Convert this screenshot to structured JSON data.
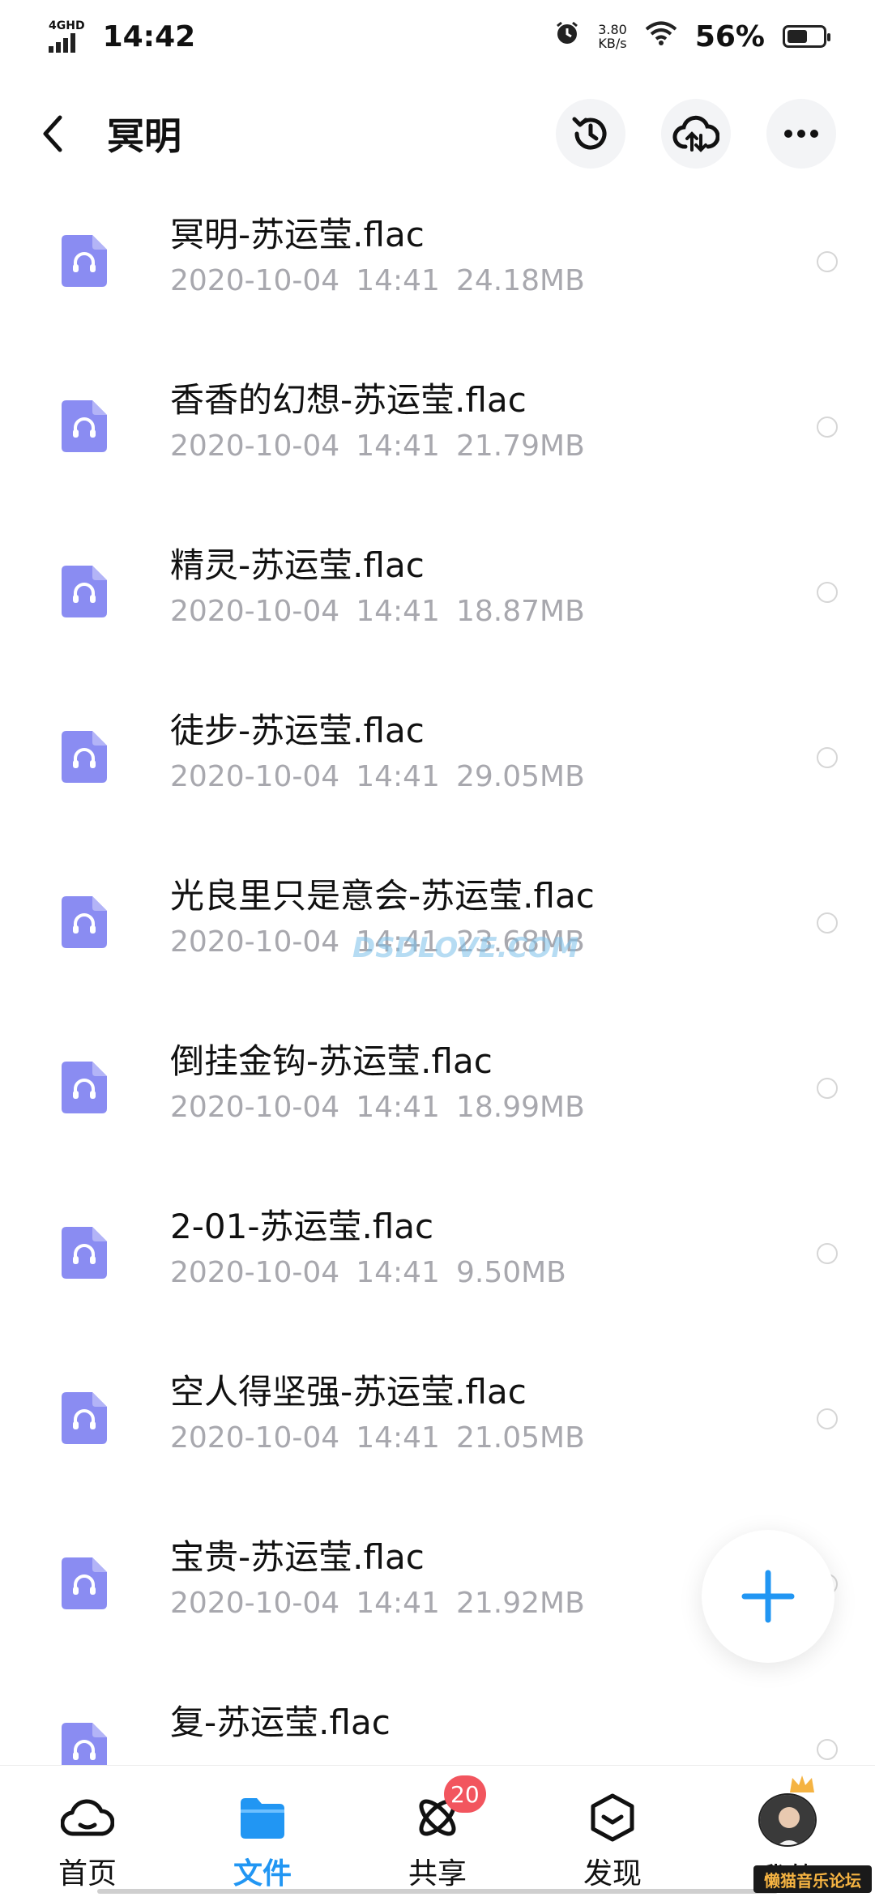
{
  "status_bar": {
    "network": "4GHD",
    "time": "14:42",
    "speed_value": "3.80",
    "speed_unit": "KB/s",
    "battery": "56%",
    "battery_level": 0.56
  },
  "header": {
    "title": "冥明"
  },
  "files": [
    {
      "name": "冥明-苏运莹.flac",
      "date": "2020-10-04",
      "time": "14:41",
      "size": "24.18MB"
    },
    {
      "name": "香香的幻想-苏运莹.flac",
      "date": "2020-10-04",
      "time": "14:41",
      "size": "21.79MB"
    },
    {
      "name": "精灵-苏运莹.flac",
      "date": "2020-10-04",
      "time": "14:41",
      "size": "18.87MB"
    },
    {
      "name": "徒步-苏运莹.flac",
      "date": "2020-10-04",
      "time": "14:41",
      "size": "29.05MB"
    },
    {
      "name": "光良里只是意会-苏运莹.flac",
      "date": "2020-10-04",
      "time": "14:41",
      "size": "23.68MB"
    },
    {
      "name": "倒挂金钩-苏运莹.flac",
      "date": "2020-10-04",
      "time": "14:41",
      "size": "18.99MB"
    },
    {
      "name": "2-01-苏运莹.flac",
      "date": "2020-10-04",
      "time": "14:41",
      "size": "9.50MB"
    },
    {
      "name": "空人得坚强-苏运莹.flac",
      "date": "2020-10-04",
      "time": "14:41",
      "size": "21.05MB"
    },
    {
      "name": "宝贵-苏运莹.flac",
      "date": "2020-10-04",
      "time": "14:41",
      "size": "21.92MB"
    },
    {
      "name": "复-苏运莹.flac",
      "date": "",
      "time": "",
      "size": ""
    }
  ],
  "watermark": "DSDLOVE.COM",
  "tabs": [
    {
      "label": "首页",
      "icon": "cloud-icon"
    },
    {
      "label": "文件",
      "icon": "folder-icon"
    },
    {
      "label": "共享",
      "icon": "atom-icon",
      "badge": "20"
    },
    {
      "label": "发现",
      "icon": "cube-icon"
    },
    {
      "label": "我的",
      "icon": "avatar"
    }
  ],
  "forum_tag": "懒猫音乐论坛",
  "colors": {
    "accent": "#2196f3",
    "file_icon": "#8a8cf2",
    "badge": "#f2555e",
    "meta_text": "#a8a8ae"
  }
}
